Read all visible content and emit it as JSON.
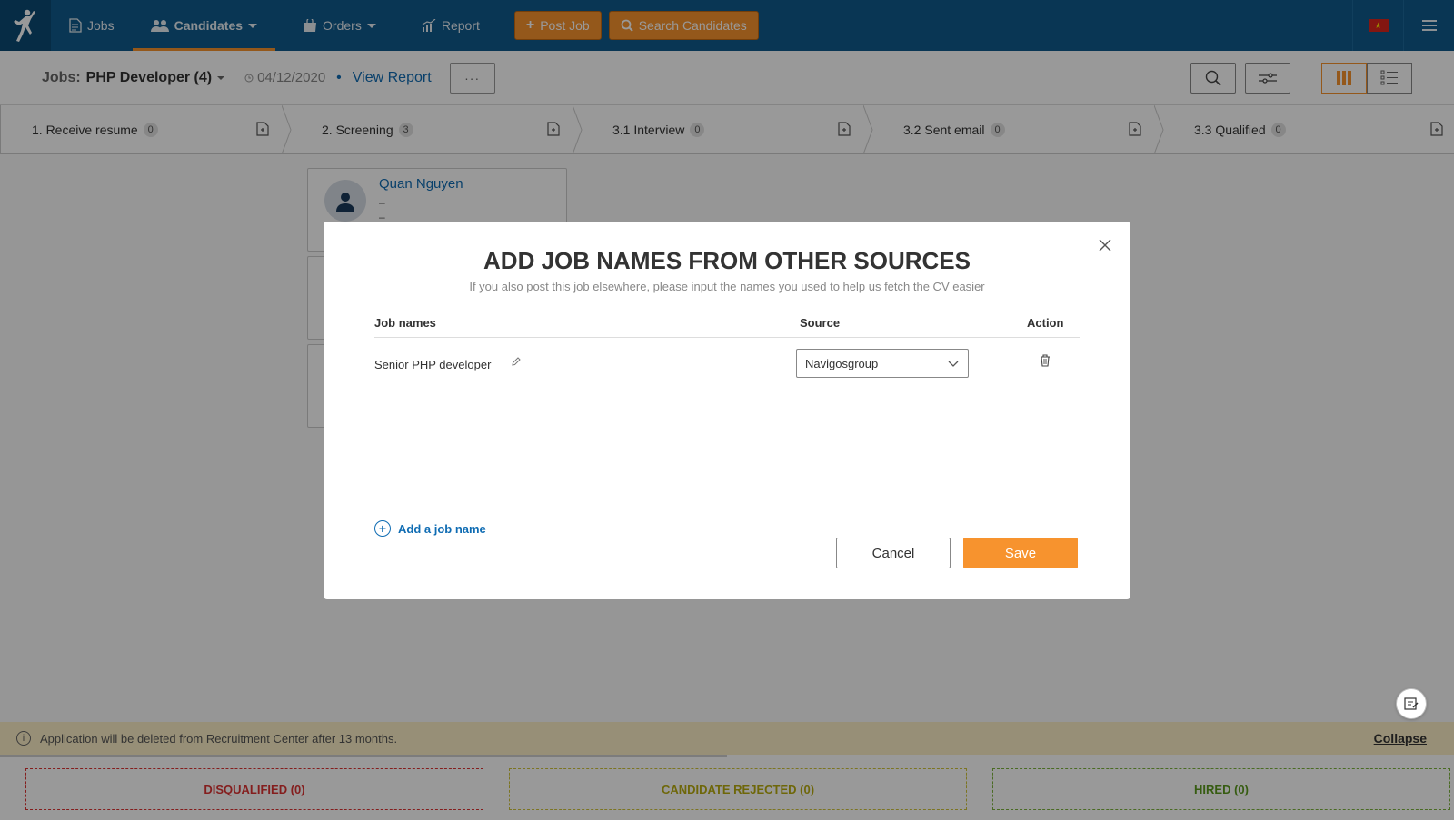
{
  "nav": {
    "items": [
      {
        "label": "Jobs"
      },
      {
        "label": "Candidates"
      },
      {
        "label": "Orders"
      },
      {
        "label": "Report"
      }
    ],
    "post_job": "Post Job",
    "search_candidates": "Search Candidates",
    "accent": "#f7932e",
    "bar_color": "#0f5a8c"
  },
  "subheader": {
    "jobs_label": "Jobs:",
    "job_title": "PHP Developer (4)",
    "date": "04/12/2020",
    "separator": "•",
    "view_report": "View Report",
    "more": "···"
  },
  "stages": [
    {
      "label": "1. Receive resume",
      "count": "0"
    },
    {
      "label": "2. Screening",
      "count": "3"
    },
    {
      "label": "3.1 Interview",
      "count": "0"
    },
    {
      "label": "3.2 Sent email",
      "count": "0"
    },
    {
      "label": "3.3 Qualified",
      "count": "0"
    }
  ],
  "candidate": {
    "name": "Quan Nguyen",
    "line1": "–",
    "line2": "–"
  },
  "footer": {
    "notice": "Application will be deleted from Recruitment Center after 13 months.",
    "collapse": "Collapse",
    "disqualified": "DISQUALIFIED (0)",
    "rejected": "CANDIDATE REJECTED (0)",
    "hired": "HIRED (0)"
  },
  "modal": {
    "title": "ADD JOB NAMES FROM OTHER SOURCES",
    "subtitle": "If you also post this job elsewhere, please input the names you used to help us fetch the CV easier",
    "col_job_names": "Job names",
    "col_source": "Source",
    "col_action": "Action",
    "rows": [
      {
        "job_name": "Senior PHP developer",
        "source": "Navigosgroup"
      }
    ],
    "add_job_name": "Add a job name",
    "cancel": "Cancel",
    "save": "Save"
  }
}
